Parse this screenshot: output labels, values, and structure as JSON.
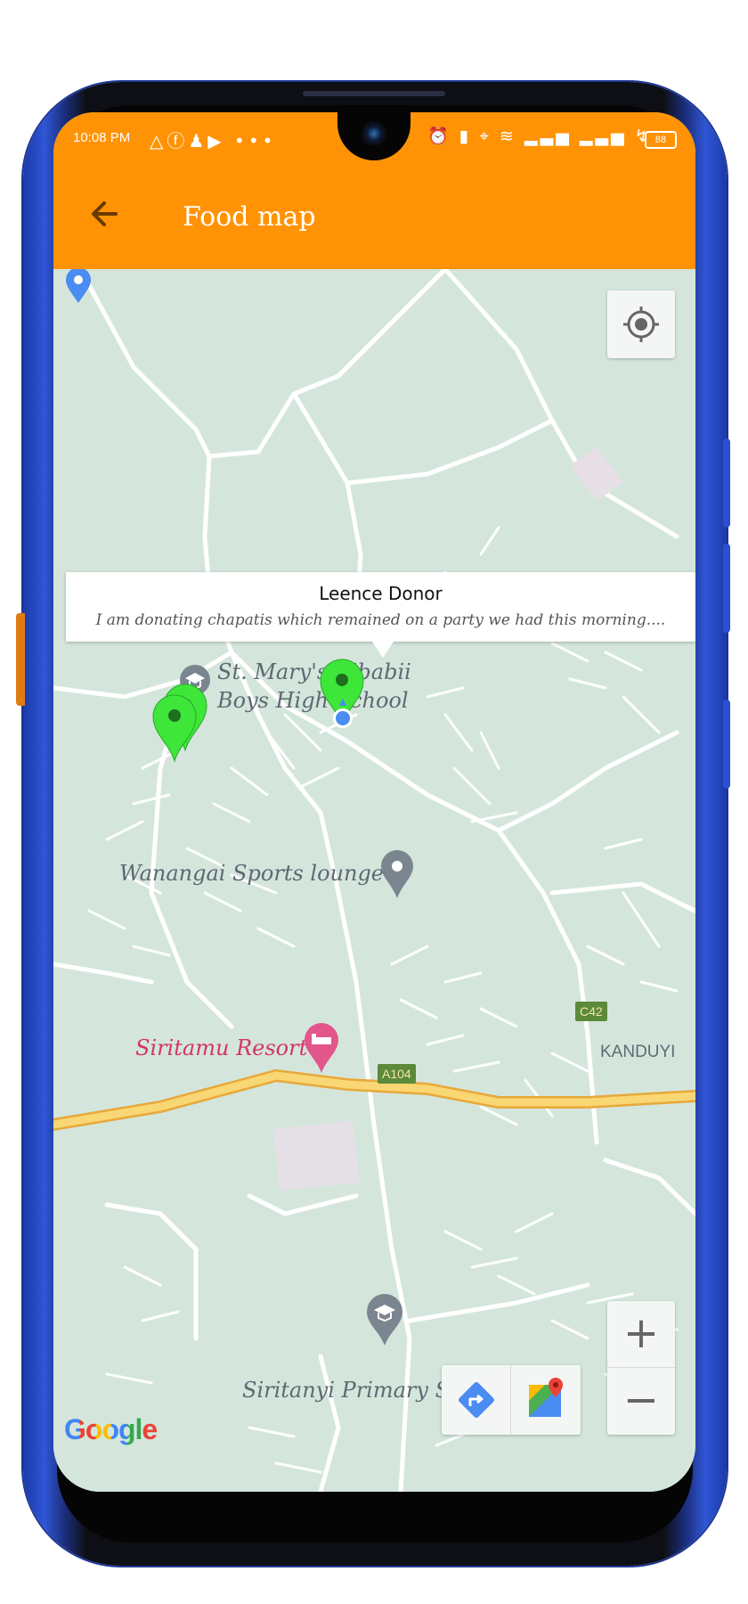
{
  "status_bar": {
    "time": "10:08 PM",
    "battery": "88"
  },
  "app_bar": {
    "title": "Food map",
    "back_icon": "arrow-left-icon"
  },
  "info_window": {
    "title": "Leence Donor",
    "snippet": "I am donating chapatis which remained on a party we had this morning...."
  },
  "map_labels": {
    "school_1_line1": "St. Mary's Kibabii",
    "school_1_line2": "Boys High School",
    "lounge": "Wanangai Sports lounge",
    "resort": "Siritamu Resort",
    "school_2": "Siritanyi Primary School",
    "area": "KANDUYI",
    "road_a104": "A104",
    "road_c42": "C42"
  },
  "map_controls": {
    "zoom_in": "+",
    "zoom_out": "−",
    "my_location_icon": "crosshair-icon",
    "directions_icon": "directions-icon",
    "maps_icon": "google-maps-icon"
  },
  "attribution": {
    "logo": "Google"
  },
  "colors": {
    "app_bar": "#ff9305",
    "marker": "#3ee63a",
    "map_bg": "#d4e6dc",
    "highway": "#f5c84a"
  }
}
